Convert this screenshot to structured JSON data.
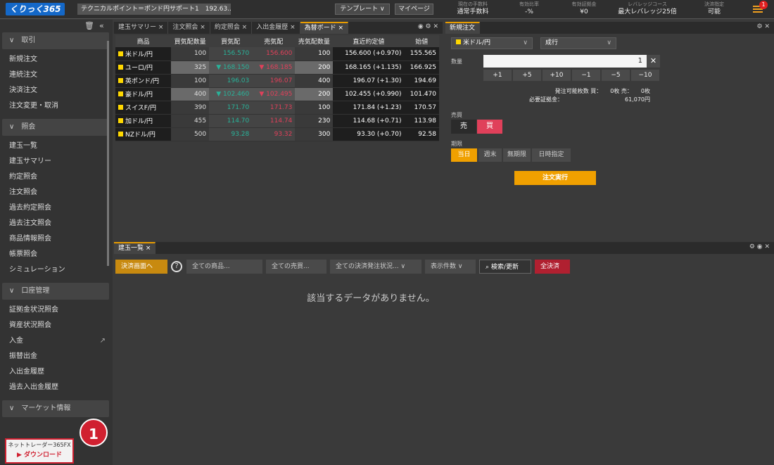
{
  "header": {
    "logo": "くりっく365",
    "news": "テクニカルポイント＝ポンド円サポート1　192.63...",
    "template": "テンプレート ∨",
    "mypage": "マイページ",
    "stats": [
      {
        "label": "現在の手数料",
        "value": "通常手数料"
      },
      {
        "label": "有効比率",
        "value": "-%"
      },
      {
        "label": "有効証拠金",
        "value": "¥0"
      },
      {
        "label": "レバレッジコース",
        "value": "最大レバレッジ25倍"
      },
      {
        "label": "決済指定",
        "value": "可能"
      }
    ],
    "badge": "1"
  },
  "sidebar": {
    "sections": [
      {
        "title": "取引",
        "items": [
          "新規注文",
          "連続注文",
          "決済注文",
          "注文変更・取消"
        ]
      },
      {
        "title": "照会",
        "items": [
          "建玉一覧",
          "建玉サマリー",
          "約定照会",
          "注文照会",
          "過去約定照会",
          "過去注文照会",
          "商品情報照会",
          "帳票照会",
          "シミュレーション"
        ]
      },
      {
        "title": "口座管理",
        "items": [
          "証拠金状況照会",
          "資産状況照会",
          "入金",
          "振替出金",
          "入出金履歴",
          "過去入出金履歴"
        ]
      },
      {
        "title": "マーケット情報",
        "items": []
      }
    ],
    "download_title": "ネットトレーダー365FX",
    "download_label": "ダウンロード",
    "callout": "1"
  },
  "board": {
    "tabs": [
      "建玉サマリー ×",
      "注文照会 ×",
      "約定照会 ×",
      "入出金履歴 ×",
      "為替ボード ×"
    ],
    "headers": [
      "商品",
      "買気配数量",
      "買気配",
      "売気配",
      "売気配数量",
      "直近約定値",
      "始値"
    ],
    "rows": [
      [
        "米ドル/円",
        "100",
        "156.570",
        "156.600",
        "100",
        "156.600",
        "(+0.970)",
        "155.565"
      ],
      [
        "ユーロ/円",
        "325",
        "168.150",
        "168.185",
        "200",
        "168.165",
        "(+1.135)",
        "166.925"
      ],
      [
        "英ポンド/円",
        "100",
        "196.03",
        "196.07",
        "400",
        "196.07",
        "(+1.30)",
        "194.69"
      ],
      [
        "豪ドル/円",
        "400",
        "102.460",
        "102.495",
        "200",
        "102.455",
        "(+0.990)",
        "101.470"
      ],
      [
        "スイスF/円",
        "390",
        "171.70",
        "171.73",
        "100",
        "171.84",
        "(+1.23)",
        "170.57"
      ],
      [
        "加ドル/円",
        "455",
        "114.70",
        "114.74",
        "230",
        "114.68",
        "(+0.71)",
        "113.98"
      ],
      [
        "NZドル/円",
        "500",
        "93.28",
        "93.32",
        "300",
        "93.30",
        "(+0.70)",
        "92.58"
      ]
    ]
  },
  "order": {
    "tab": "新規注文",
    "pair": "米ドル/円",
    "type": "成行",
    "qty_label": "数量",
    "qty": "1",
    "steps": [
      "+1",
      "+5",
      "+10",
      "−1",
      "−5",
      "−10"
    ],
    "avail": "発注可能枚数 買：　　0枚 売：　　0枚",
    "margin_label": "必要証拠金：",
    "margin": "61,070円",
    "side_label": "売買",
    "sell": "売",
    "buy": "買",
    "period_label": "期限",
    "periods": [
      "当日",
      "週末",
      "無期限",
      "日時指定"
    ],
    "exec": "注文実行"
  },
  "positions": {
    "tab": "建玉一覧 ×",
    "settle_btn": "決済画面へ",
    "filters": [
      "全ての商品...",
      "全ての売買...",
      "全ての決済発注状況... ∨",
      "表示件数 ∨"
    ],
    "search": "検索/更新",
    "all_settle": "全決済",
    "empty": "該当するデータがありません。"
  },
  "colors": {
    "accent": "#f0a000",
    "bid": "#29b39a",
    "ask": "#e0405a"
  }
}
